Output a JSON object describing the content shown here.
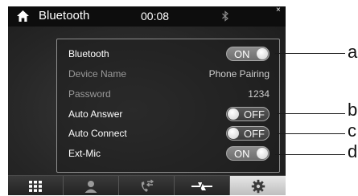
{
  "header": {
    "title": "Bluetooth",
    "time": "00:08"
  },
  "settings": [
    {
      "label": "Bluetooth",
      "kind": "toggle",
      "state": "ON",
      "enabled": true
    },
    {
      "label": "Device Name",
      "kind": "value",
      "value": "Phone Pairing",
      "enabled": false
    },
    {
      "label": "Password",
      "kind": "value",
      "value": "1234",
      "enabled": false
    },
    {
      "label": "Auto Answer",
      "kind": "toggle",
      "state": "OFF",
      "enabled": true
    },
    {
      "label": "Auto Connect",
      "kind": "toggle",
      "state": "OFF",
      "enabled": true
    },
    {
      "label": "Ext-Mic",
      "kind": "toggle",
      "state": "ON",
      "enabled": true
    }
  ],
  "callouts": [
    "a",
    "b",
    "c",
    "d"
  ],
  "bottom_nav": [
    {
      "icon": "grid-menu-icon",
      "active": false
    },
    {
      "icon": "contacts-icon",
      "active": false
    },
    {
      "icon": "call-log-icon",
      "active": false
    },
    {
      "icon": "bluetooth-link-icon",
      "active": false
    },
    {
      "icon": "settings-gear-icon",
      "active": true
    }
  ],
  "colors": {
    "background": "#262626",
    "topbar": "#0d0d0d",
    "active_tab": "#d4d4d4"
  }
}
